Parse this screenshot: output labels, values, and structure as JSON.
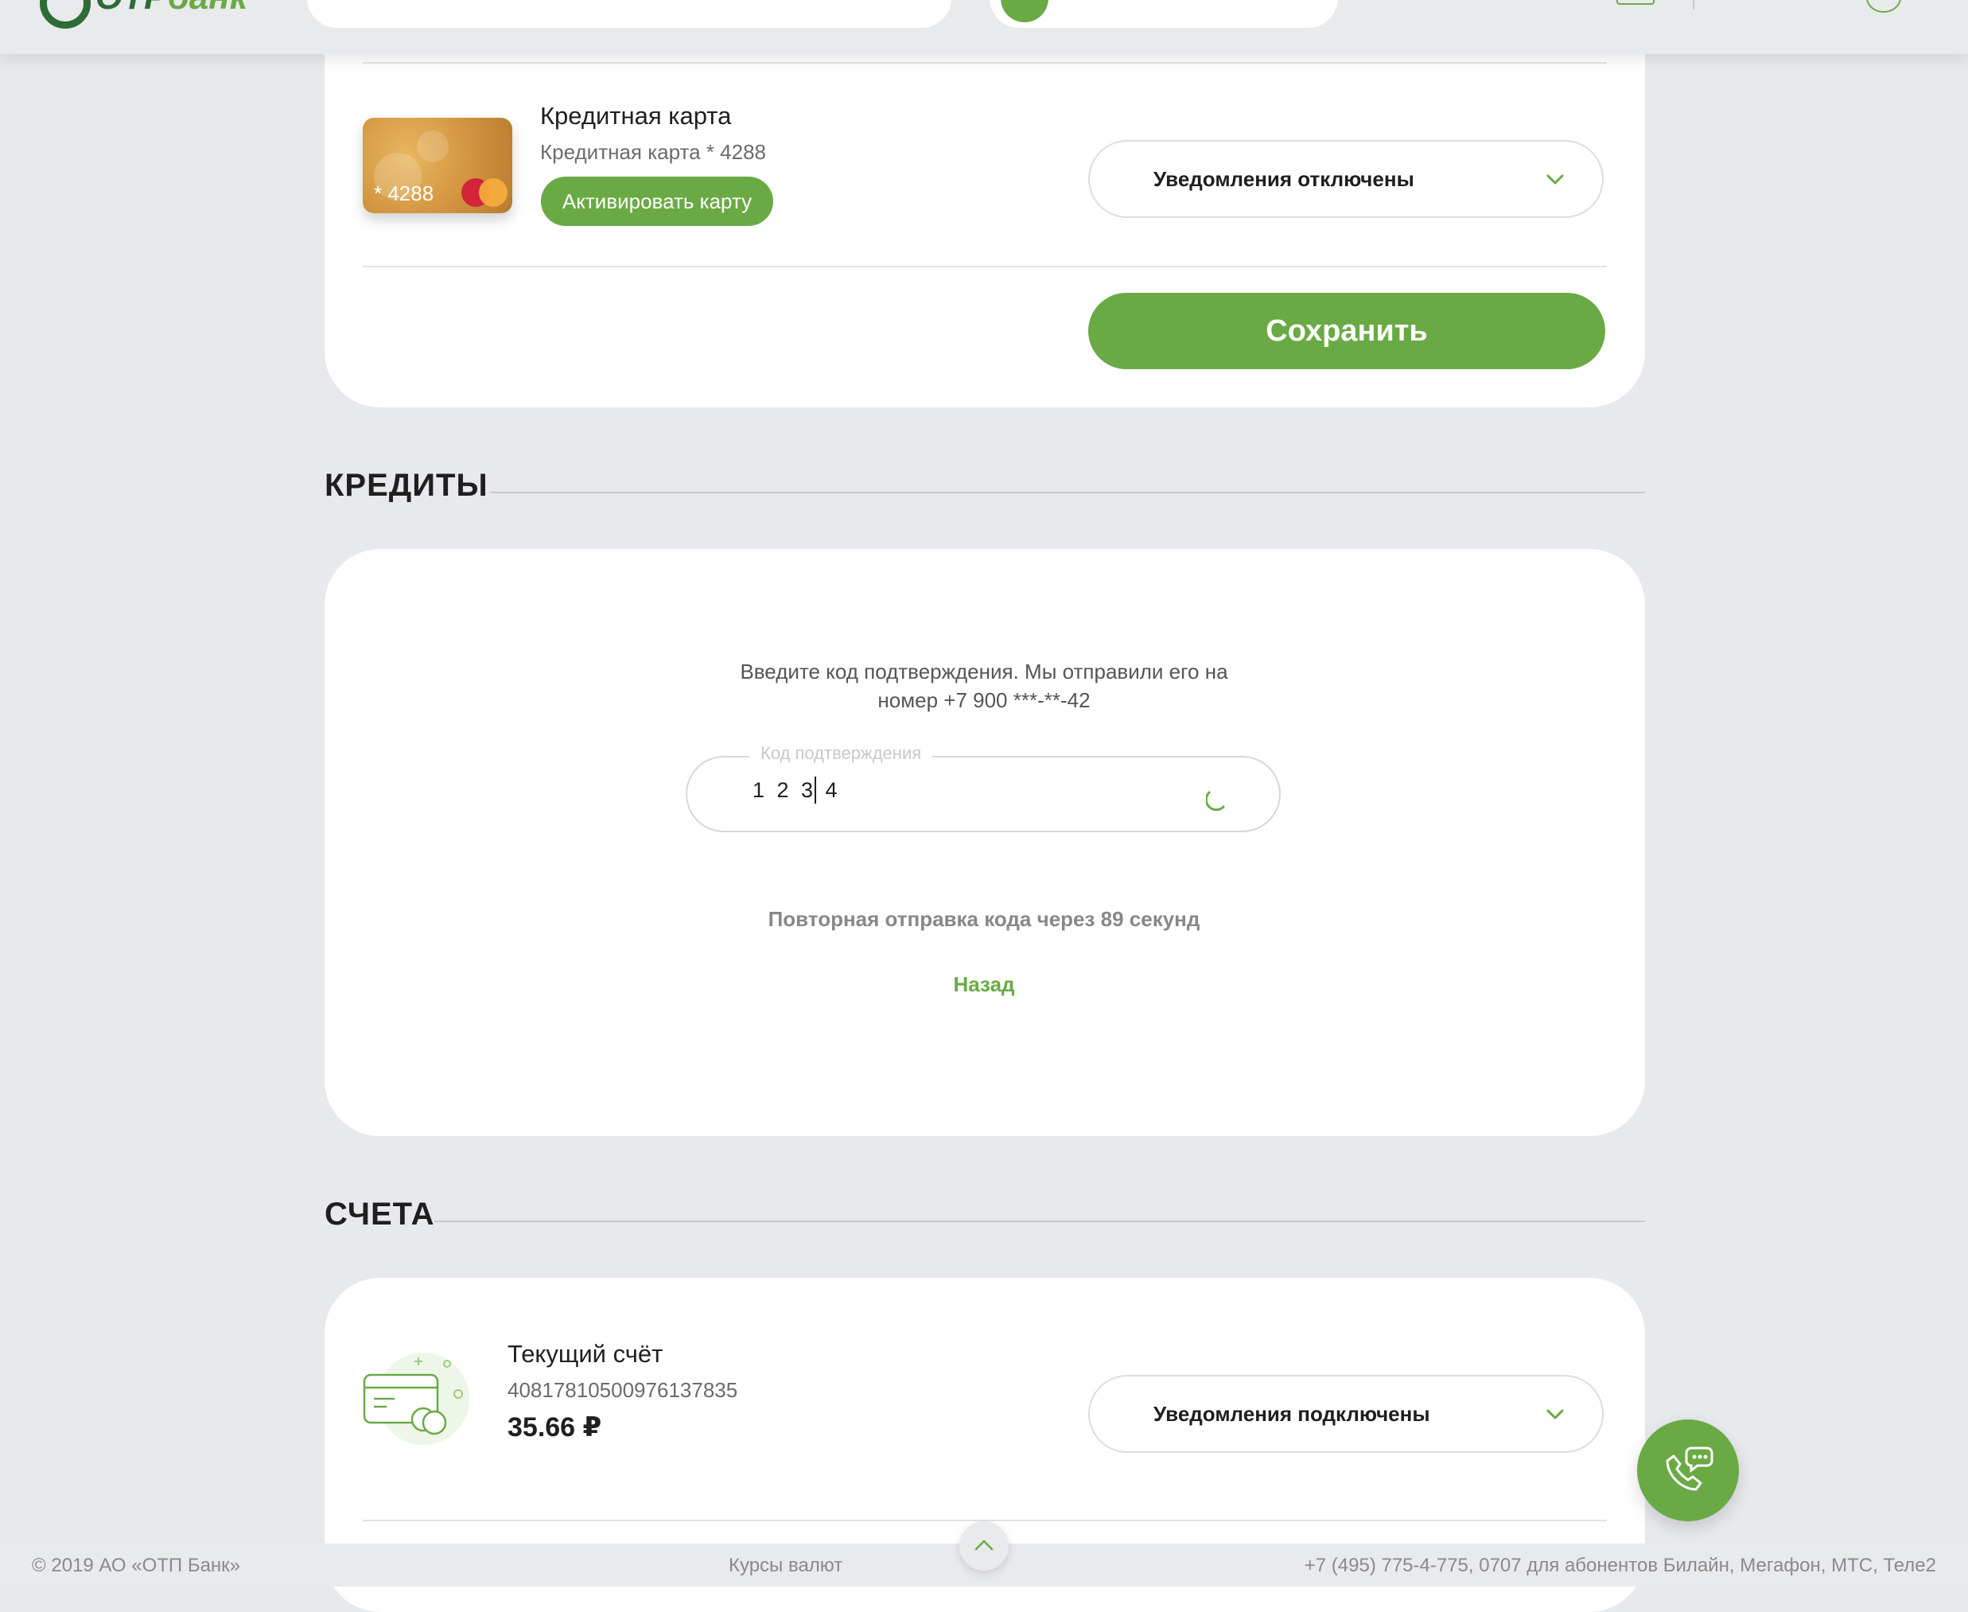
{
  "header": {
    "logo_main": "OTP",
    "logo_accent": "банк"
  },
  "cards_section": {
    "product": {
      "title": "Кредитная карта",
      "subtitle": "Кредитная карта * 4288",
      "card_number": "* 4288",
      "activate_label": "Активировать карту",
      "notifications_value": "Уведомления отключены"
    },
    "save_label": "Сохранить"
  },
  "credits_section": {
    "title": "КРЕДИТЫ",
    "confirm_text": "Введите код подтверждения. Мы отправили его на номер +7 900 ***-**-42",
    "code_label": "Код подтверждения",
    "code_value": "1 2 3 4",
    "resend_text": "Повторная отправка кода через 89 секунд",
    "back_label": "Назад"
  },
  "accounts_section": {
    "title": "СЧЕТА",
    "account": {
      "title": "Текущий счёт",
      "number": "40817810500976137835",
      "amount": "35.66 ₽",
      "notifications_value": "Уведомления подключены"
    }
  },
  "footer": {
    "copyright": "© 2019 АО «ОТП Банк»",
    "rates_link": "Курсы валют",
    "phones": "+7 (495) 775-4-775,  0707 для абонентов Билайн, Мегафон, МТС, Теле2"
  },
  "colors": {
    "accent": "#6aaa45",
    "brand_dark": "#2e6b35",
    "background": "#e8e9ec"
  }
}
